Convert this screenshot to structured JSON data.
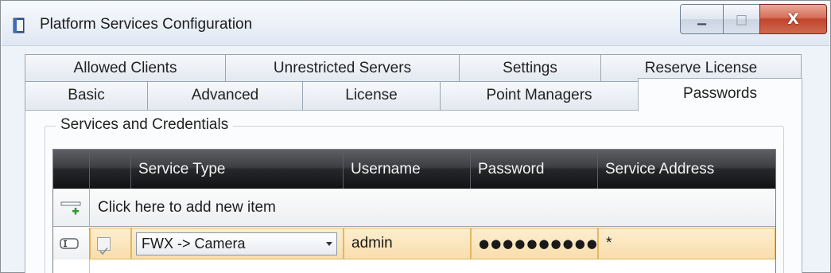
{
  "window": {
    "title": "Platform Services Configuration",
    "minimize_glyph": "▁",
    "maximize_glyph": "□",
    "close_glyph": "X",
    "close_color": "#c7472f"
  },
  "tabs": {
    "back_row": [
      {
        "label": "Allowed Clients"
      },
      {
        "label": "Unrestricted Servers"
      },
      {
        "label": "Settings"
      },
      {
        "label": "Reserve License"
      }
    ],
    "front_row": [
      {
        "label": "Basic"
      },
      {
        "label": "Advanced"
      },
      {
        "label": "License"
      },
      {
        "label": "Point Managers"
      },
      {
        "label": "Passwords",
        "active": true
      }
    ]
  },
  "group": {
    "title": "Services and Credentials"
  },
  "grid": {
    "columns": [
      "",
      "",
      "Service Type",
      "Username",
      "Password",
      "Service Address"
    ],
    "add_row_label": "Click here to add new item",
    "add_icon": "add-row-icon",
    "rows": [
      {
        "checked": true,
        "service_type": "FWX -> Camera",
        "username": "admin",
        "password": "●●●●●●●●●●●",
        "service_address": "*"
      }
    ],
    "header_color": "#26282b",
    "selected_row_color": "#f9ddac"
  }
}
